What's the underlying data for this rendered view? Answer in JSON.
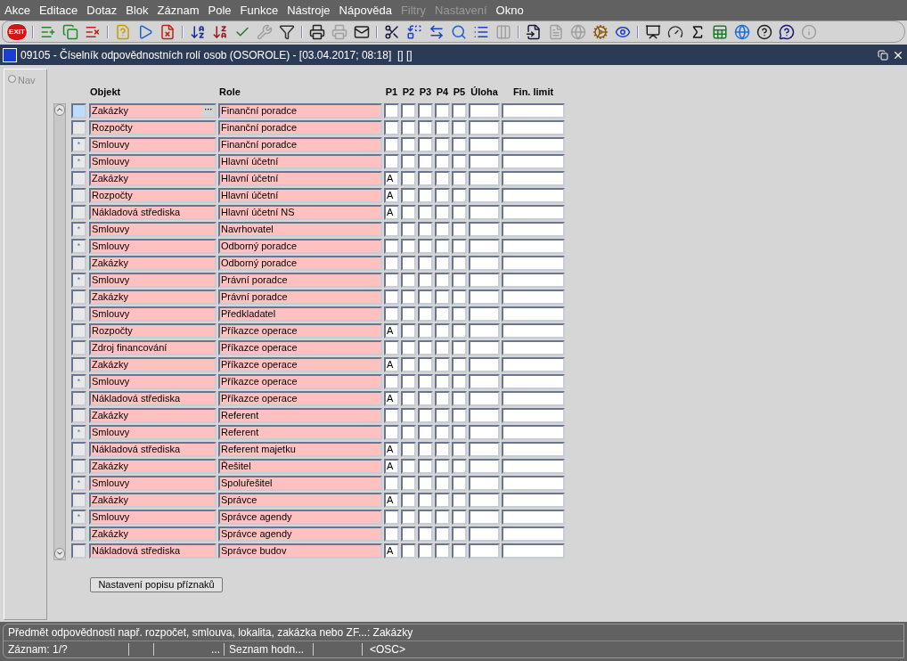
{
  "menu": [
    {
      "label": "Akce",
      "disabled": false
    },
    {
      "label": "Editace",
      "disabled": false
    },
    {
      "label": "Dotaz",
      "disabled": false
    },
    {
      "label": "Blok",
      "disabled": false
    },
    {
      "label": "Záznam",
      "disabled": false
    },
    {
      "label": "Pole",
      "disabled": false
    },
    {
      "label": "Funkce",
      "disabled": false
    },
    {
      "label": "Nástroje",
      "disabled": false
    },
    {
      "label": "Nápověda",
      "disabled": false
    },
    {
      "label": "Filtry",
      "disabled": true
    },
    {
      "label": "Nastavení",
      "disabled": true
    },
    {
      "label": "Okno",
      "disabled": false
    }
  ],
  "toolbar": [
    {
      "kind": "exit",
      "label": "EXIT",
      "disabled": false
    },
    {
      "kind": "sep"
    },
    {
      "kind": "add",
      "disabled": false
    },
    {
      "kind": "copy",
      "disabled": false
    },
    {
      "kind": "delete",
      "disabled": false
    },
    {
      "kind": "sep"
    },
    {
      "kind": "query",
      "disabled": false
    },
    {
      "kind": "run",
      "disabled": false
    },
    {
      "kind": "cancel",
      "disabled": false
    },
    {
      "kind": "sep"
    },
    {
      "kind": "sort-asc",
      "disabled": false
    },
    {
      "kind": "sort-desc",
      "disabled": false
    },
    {
      "kind": "check",
      "disabled": false
    },
    {
      "kind": "wrench",
      "disabled": true
    },
    {
      "kind": "filter",
      "disabled": false
    },
    {
      "kind": "sep"
    },
    {
      "kind": "print",
      "disabled": false
    },
    {
      "kind": "printer",
      "disabled": true
    },
    {
      "kind": "mail",
      "disabled": false
    },
    {
      "kind": "sep"
    },
    {
      "kind": "scissors",
      "disabled": false
    },
    {
      "kind": "replace",
      "disabled": false
    },
    {
      "kind": "swap",
      "disabled": false
    },
    {
      "kind": "search",
      "disabled": false
    },
    {
      "kind": "list",
      "disabled": false
    },
    {
      "kind": "columns",
      "disabled": true
    },
    {
      "kind": "sep"
    },
    {
      "kind": "import",
      "disabled": false
    },
    {
      "kind": "document",
      "disabled": true
    },
    {
      "kind": "globe",
      "disabled": true
    },
    {
      "kind": "cog",
      "disabled": false
    },
    {
      "kind": "eye",
      "disabled": false
    },
    {
      "kind": "sep"
    },
    {
      "kind": "chart",
      "disabled": false
    },
    {
      "kind": "gauge",
      "disabled": false
    },
    {
      "kind": "sigma",
      "disabled": false
    },
    {
      "kind": "sheet",
      "disabled": false
    },
    {
      "kind": "browser",
      "disabled": false
    },
    {
      "kind": "help",
      "disabled": false
    },
    {
      "kind": "context-help",
      "disabled": false
    },
    {
      "kind": "info",
      "disabled": true
    }
  ],
  "window": {
    "title": "09105 - Číselník odpovědnostních rolí osob (OSOROLE) - [03.04.2017; 08:18]  [] []"
  },
  "nav": {
    "label": "Nav",
    "selected": false
  },
  "table": {
    "columns": [
      "Objekt",
      "Role",
      "P1",
      "P2",
      "P3",
      "P4",
      "P5",
      "Úloha",
      "Fin. limit"
    ],
    "rows": [
      {
        "marker": "",
        "selected": true,
        "objekt": "Zakázky",
        "role": "Finanční poradce",
        "p1": ""
      },
      {
        "marker": "",
        "selected": false,
        "objekt": "Rozpočty",
        "role": "Finanční poradce",
        "p1": ""
      },
      {
        "marker": "*",
        "selected": false,
        "objekt": "Smlouvy",
        "role": "Finanční poradce",
        "p1": ""
      },
      {
        "marker": "*",
        "selected": false,
        "objekt": "Smlouvy",
        "role": "Hlavní účetní",
        "p1": ""
      },
      {
        "marker": "",
        "selected": false,
        "objekt": "Zakázky",
        "role": "Hlavní účetní",
        "p1": "A"
      },
      {
        "marker": "",
        "selected": false,
        "objekt": "Rozpočty",
        "role": "Hlavní účetní",
        "p1": "A"
      },
      {
        "marker": "",
        "selected": false,
        "objekt": "Nákladová střediska",
        "role": "Hlavní účetní NS",
        "p1": "A"
      },
      {
        "marker": "*",
        "selected": false,
        "objekt": "Smlouvy",
        "role": "Navrhovatel",
        "p1": ""
      },
      {
        "marker": "*",
        "selected": false,
        "objekt": "Smlouvy",
        "role": "Odborný poradce",
        "p1": ""
      },
      {
        "marker": "",
        "selected": false,
        "objekt": "Zakázky",
        "role": "Odborný poradce",
        "p1": ""
      },
      {
        "marker": "*",
        "selected": false,
        "objekt": "Smlouvy",
        "role": "Právní poradce",
        "p1": ""
      },
      {
        "marker": "",
        "selected": false,
        "objekt": "Zakázky",
        "role": "Právní poradce",
        "p1": ""
      },
      {
        "marker": "",
        "selected": false,
        "objekt": "Smlouvy",
        "role": "Předkladatel",
        "p1": ""
      },
      {
        "marker": "",
        "selected": false,
        "objekt": "Rozpočty",
        "role": "Příkazce operace",
        "p1": "A"
      },
      {
        "marker": "",
        "selected": false,
        "objekt": "Zdroj financování",
        "role": "Příkazce operace",
        "p1": ""
      },
      {
        "marker": "",
        "selected": false,
        "objekt": "Zakázky",
        "role": "Příkazce operace",
        "p1": "A"
      },
      {
        "marker": "*",
        "selected": false,
        "objekt": "Smlouvy",
        "role": "Příkazce operace",
        "p1": ""
      },
      {
        "marker": "",
        "selected": false,
        "objekt": "Nákladová střediska",
        "role": "Příkazce operace",
        "p1": "A"
      },
      {
        "marker": "",
        "selected": false,
        "objekt": "Zakázky",
        "role": "Referent",
        "p1": ""
      },
      {
        "marker": "*",
        "selected": false,
        "objekt": "Smlouvy",
        "role": "Referent",
        "p1": ""
      },
      {
        "marker": "",
        "selected": false,
        "objekt": "Nákladová střediska",
        "role": "Referent majetku",
        "p1": "A"
      },
      {
        "marker": "",
        "selected": false,
        "objekt": "Zakázky",
        "role": "Řešitel",
        "p1": "A"
      },
      {
        "marker": "*",
        "selected": false,
        "objekt": "Smlouvy",
        "role": "Spoluřešitel",
        "p1": ""
      },
      {
        "marker": "",
        "selected": false,
        "objekt": "Zakázky",
        "role": "Správce",
        "p1": "A"
      },
      {
        "marker": "*",
        "selected": false,
        "objekt": "Smlouvy",
        "role": "Správce agendy",
        "p1": ""
      },
      {
        "marker": "",
        "selected": false,
        "objekt": "Zakázky",
        "role": "Správce agendy",
        "p1": ""
      },
      {
        "marker": "",
        "selected": false,
        "objekt": "Nákladová střediska",
        "role": "Správce budov",
        "p1": "A"
      }
    ]
  },
  "lov_button": "···",
  "flags_button": "Nastavení popisu příznaků",
  "status": {
    "hint": "Předmět odpovědnosti např. rozpočet, smlouva, lokalita, zakázka nebo ZF...: Zakázky",
    "record": "Záznam: 1/?",
    "field_3": "...",
    "field_4": "Seznam hodn...",
    "field_6": "<OSC>"
  }
}
